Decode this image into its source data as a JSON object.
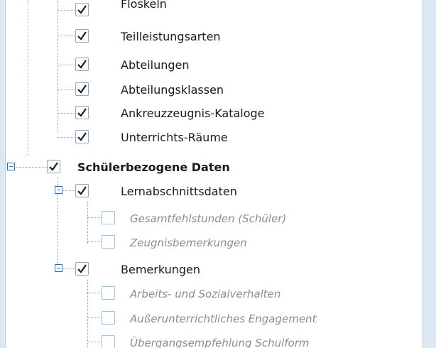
{
  "tree": {
    "nodes": [
      {
        "label": "Floskeln",
        "checked": true
      },
      {
        "label": "Teilleistungsarten",
        "checked": true
      },
      {
        "label": "Abteilungen",
        "checked": true
      },
      {
        "label": "Abteilungsklassen",
        "checked": true
      },
      {
        "label": "Ankreuzzeugnis-Kataloge",
        "checked": true
      },
      {
        "label": "Unterrichts-Räume",
        "checked": true
      },
      {
        "label": "Schülerbezogene Daten",
        "checked": true,
        "expanded": true
      },
      {
        "label": "Lernabschnittsdaten",
        "checked": true,
        "expanded": true
      },
      {
        "label": "Gesamtfehlstunden (Schüler)",
        "checked": false,
        "disabled": true
      },
      {
        "label": "Zeugnisbemerkungen",
        "checked": false,
        "disabled": true
      },
      {
        "label": "Bemerkungen",
        "checked": true,
        "expanded": true
      },
      {
        "label": "Arbeits- und Sozialverhalten",
        "checked": false,
        "disabled": true
      },
      {
        "label": "Außerunterrichtliches Engagement",
        "checked": false,
        "disabled": true
      },
      {
        "label": "Übergangsempfehlung Schulform",
        "checked": false,
        "disabled": true
      }
    ]
  },
  "colors": {
    "check": "#1f1f1f",
    "checkbox_border": "#8fa8c8",
    "expander": "#2b6cb8",
    "disabled_text": "#8c8c8c",
    "frame": "#dde8f4"
  }
}
